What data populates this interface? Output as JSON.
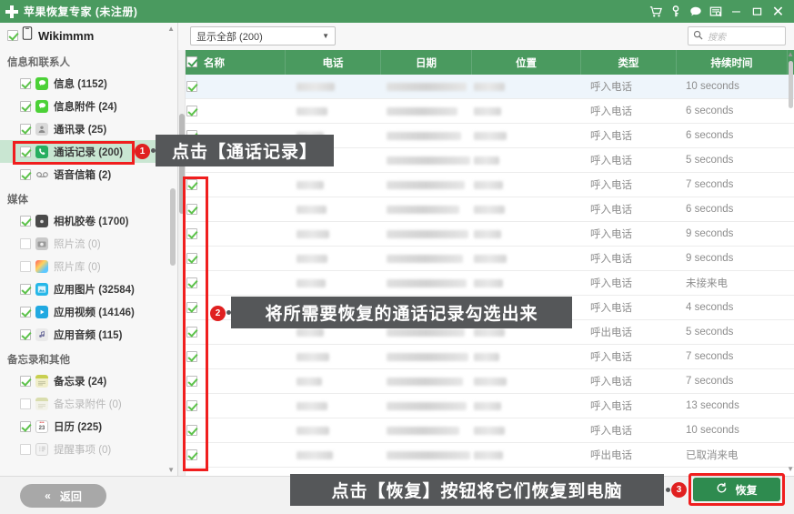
{
  "window": {
    "title": "苹果恢复专家 (未注册)",
    "logo_icon": "plus-cross-icon",
    "icons": [
      {
        "name": "cart-icon",
        "glyph": "Ὥ2"
      },
      {
        "name": "key-icon",
        "glyph": "key"
      },
      {
        "name": "chat-icon",
        "glyph": "chat"
      },
      {
        "name": "feedback-icon",
        "glyph": "feedback"
      }
    ],
    "minimize": "–",
    "maximize": "☐",
    "close": "✕",
    "accent_color": "#4a9a5f"
  },
  "sidebar": {
    "device": {
      "label": "Wikimmm",
      "checked": true,
      "icon": "phone-device-icon"
    },
    "groups": [
      {
        "title": "信息和联系人",
        "items": [
          {
            "label": "信息 (1152)",
            "checked": true,
            "dim": false,
            "icon": "message-icon"
          },
          {
            "label": "信息附件 (24)",
            "checked": true,
            "dim": false,
            "icon": "message-attachment-icon"
          },
          {
            "label": "通讯录 (25)",
            "checked": true,
            "dim": false,
            "icon": "contacts-icon"
          },
          {
            "label": "通话记录 (200)",
            "checked": true,
            "dim": false,
            "icon": "call-history-icon",
            "selected": true
          },
          {
            "label": "语音信箱 (2)",
            "checked": true,
            "dim": false,
            "icon": "voicemail-icon"
          }
        ]
      },
      {
        "title": "媒体",
        "items": [
          {
            "label": "相机胶卷 (1700)",
            "checked": true,
            "dim": false,
            "icon": "camera-roll-icon"
          },
          {
            "label": "照片流 (0)",
            "checked": false,
            "dim": true,
            "icon": "photo-stream-icon"
          },
          {
            "label": "照片库 (0)",
            "checked": false,
            "dim": true,
            "icon": "photo-library-icon"
          },
          {
            "label": "应用图片 (32584)",
            "checked": true,
            "dim": false,
            "icon": "app-photos-icon"
          },
          {
            "label": "应用视频 (14146)",
            "checked": true,
            "dim": false,
            "icon": "app-videos-icon"
          },
          {
            "label": "应用音频 (115)",
            "checked": true,
            "dim": false,
            "icon": "app-audio-icon"
          }
        ]
      },
      {
        "title": "备忘录和其他",
        "items": [
          {
            "label": "备忘录 (24)",
            "checked": true,
            "dim": false,
            "icon": "notes-icon"
          },
          {
            "label": "备忘录附件 (0)",
            "checked": false,
            "dim": true,
            "icon": "notes-attachment-icon"
          },
          {
            "label": "日历 (225)",
            "checked": true,
            "dim": false,
            "icon": "calendar-icon"
          },
          {
            "label": "提醒事项 (0)",
            "checked": false,
            "dim": true,
            "icon": "reminders-icon"
          }
        ]
      }
    ]
  },
  "toolbar": {
    "filter_value": "显示全部 (200)",
    "caret_icon": "chevron-down-icon",
    "search_icon": "search-icon",
    "search_placeholder": "搜索",
    "search_value": ""
  },
  "table": {
    "header_checkbox_checked": true,
    "columns": [
      "名称",
      "电话",
      "日期",
      "位置",
      "类型",
      "持续时间"
    ],
    "rows": [
      {
        "checked": true,
        "type": "呼入电话",
        "duration": "10 seconds",
        "selected": true
      },
      {
        "checked": true,
        "type": "呼入电话",
        "duration": "6 seconds"
      },
      {
        "checked": true,
        "type": "呼入电话",
        "duration": "6 seconds"
      },
      {
        "checked": true,
        "type": "呼入电话",
        "duration": "5 seconds"
      },
      {
        "checked": true,
        "type": "呼入电话",
        "duration": "7 seconds"
      },
      {
        "checked": true,
        "type": "呼入电话",
        "duration": "6 seconds"
      },
      {
        "checked": true,
        "type": "呼入电话",
        "duration": "9 seconds"
      },
      {
        "checked": true,
        "type": "呼入电话",
        "duration": "9 seconds"
      },
      {
        "checked": true,
        "type": "呼入电话",
        "duration": "未接来电"
      },
      {
        "checked": true,
        "type": "呼入电话",
        "duration": "4 seconds"
      },
      {
        "checked": true,
        "type": "呼出电话",
        "duration": "5 seconds"
      },
      {
        "checked": true,
        "type": "呼入电话",
        "duration": "7 seconds"
      },
      {
        "checked": true,
        "type": "呼入电话",
        "duration": "7 seconds"
      },
      {
        "checked": true,
        "type": "呼入电话",
        "duration": "13 seconds"
      },
      {
        "checked": true,
        "type": "呼入电话",
        "duration": "10 seconds"
      },
      {
        "checked": true,
        "type": "呼出电话",
        "duration": "已取消来电"
      }
    ]
  },
  "footer": {
    "back_label": "返回",
    "back_icon": "double-chevron-left-icon",
    "recover_label": "恢复",
    "recover_icon": "refresh-recover-icon"
  },
  "annotations": [
    {
      "number": "1",
      "text": "点击【通话记录】"
    },
    {
      "number": "2",
      "text": "将所需要恢复的通话记录勾选出来"
    },
    {
      "number": "3",
      "text": "点击【恢复】按钮将它们恢复到电脑"
    }
  ],
  "colors": {
    "accent_green": "#4a9a5f",
    "highlight_red": "#f01e1e",
    "callout_bg": "#555759",
    "badge_red": "#e02020",
    "selected_row_green": "#c9e6d2"
  }
}
